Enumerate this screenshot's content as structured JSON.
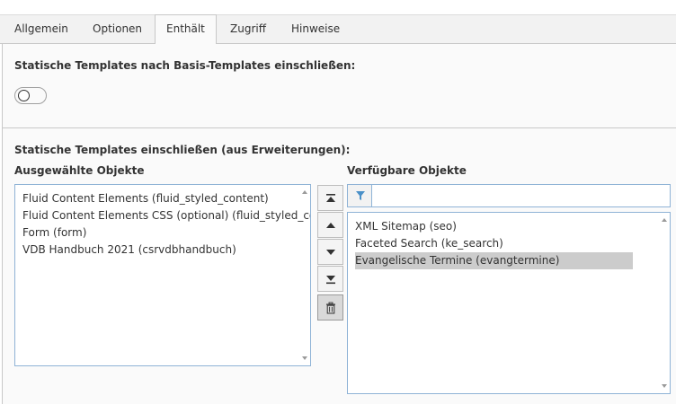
{
  "tabs": [
    {
      "label": "Allgemein",
      "active": false
    },
    {
      "label": "Optionen",
      "active": false
    },
    {
      "label": "Enthält",
      "active": true
    },
    {
      "label": "Zugriff",
      "active": false
    },
    {
      "label": "Hinweise",
      "active": false
    }
  ],
  "section_basis": {
    "label": "Statische Templates nach Basis-Templates einschließen:",
    "toggle_on": false
  },
  "section_extensions": {
    "label": "Statische Templates einschließen (aus Erweiterungen):",
    "selected_label": "Ausgewählte Objekte",
    "available_label": "Verfügbare Objekte",
    "selected_items": [
      "Fluid Content Elements (fluid_styled_content)",
      "Fluid Content Elements CSS (optional) (fluid_styled_content)",
      "Form (form)",
      "VDB Handbuch 2021 (csrvdbhandbuch)"
    ],
    "available_items": [
      "XML Sitemap (seo)",
      "Faceted Search (ke_search)",
      "Evangelische Termine (evangtermine)"
    ],
    "available_selected_index": 2,
    "filter_value": "",
    "buttons": [
      "move-to-top-icon",
      "move-up-icon",
      "move-down-icon",
      "move-to-bottom-icon",
      "trash-icon"
    ]
  },
  "colors": {
    "selection": "#cccccc",
    "list_border": "#8fb3d6",
    "filter_icon": "#4a90c8"
  }
}
